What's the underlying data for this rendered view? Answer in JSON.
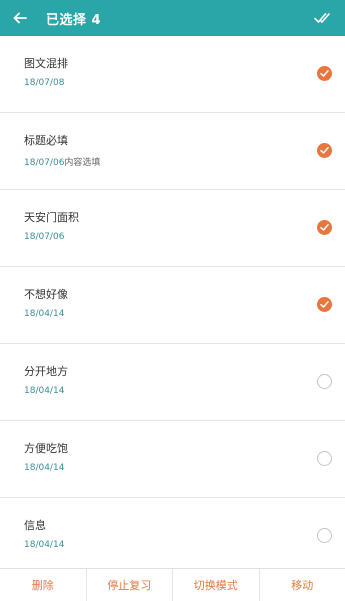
{
  "header": {
    "title": "已选择 4",
    "back_icon": "arrow-left-icon",
    "select_all_icon": "double-check-icon"
  },
  "items": [
    {
      "title": "图文混排",
      "date": "18/07/08",
      "extra": "",
      "checked": true
    },
    {
      "title": "标题必填",
      "date": "18/07/06",
      "extra": "内容选填",
      "checked": true
    },
    {
      "title": "天安门面积",
      "date": "18/07/06",
      "extra": "",
      "checked": true
    },
    {
      "title": "不想好像",
      "date": "18/04/14",
      "extra": "",
      "checked": true
    },
    {
      "title": "分开地方",
      "date": "18/04/14",
      "extra": "",
      "checked": false
    },
    {
      "title": "方便吃饱",
      "date": "18/04/14",
      "extra": "",
      "checked": false
    },
    {
      "title": "信息",
      "date": "18/04/14",
      "extra": "",
      "checked": false
    }
  ],
  "bottom": {
    "delete_label": "删除",
    "stop_review_label": "停止复习",
    "switch_mode_label": "切换模式",
    "move_label": "移动"
  },
  "colors": {
    "accent": "#2aa6a8",
    "check": "#e8773f",
    "date": "#3a8f99"
  }
}
